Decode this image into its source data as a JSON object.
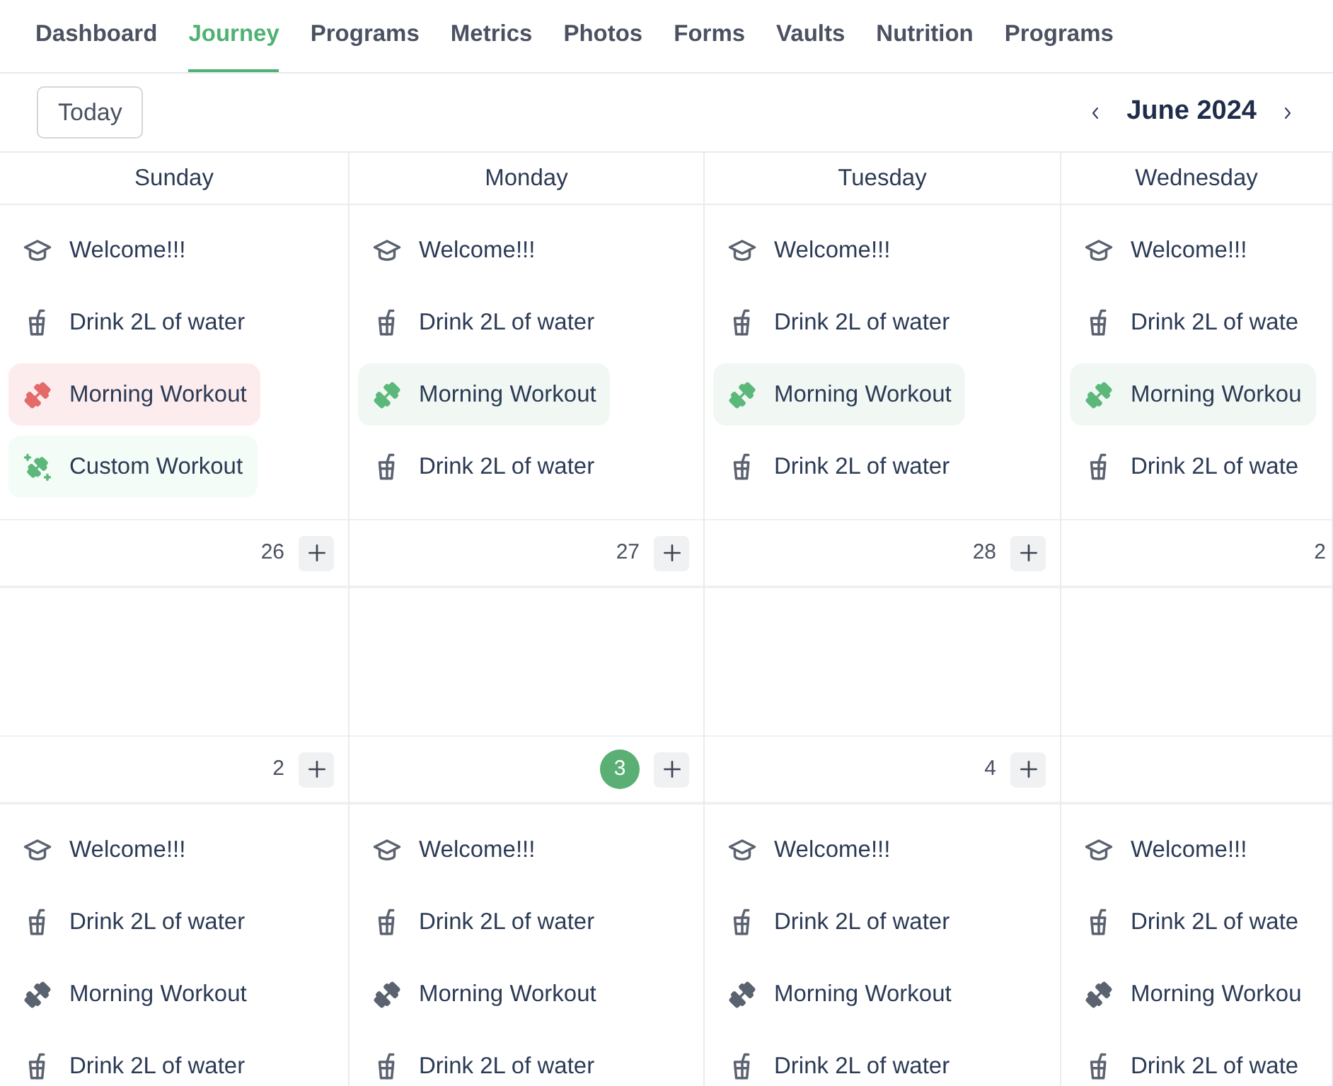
{
  "tabs": [
    {
      "label": "Dashboard",
      "selected": false
    },
    {
      "label": "Journey",
      "selected": true
    },
    {
      "label": "Programs",
      "selected": false
    },
    {
      "label": "Metrics",
      "selected": false
    },
    {
      "label": "Photos",
      "selected": false
    },
    {
      "label": "Forms",
      "selected": false
    },
    {
      "label": "Vaults",
      "selected": false
    },
    {
      "label": "Nutrition",
      "selected": false
    },
    {
      "label": "Programs",
      "selected": false
    }
  ],
  "toolbar": {
    "today_button": "Today",
    "month": "June 2024"
  },
  "calendar": {
    "days": [
      "Sunday",
      "Monday",
      "Tuesday",
      "Wednesday"
    ],
    "weeks": [
      {
        "cells": [
          {
            "events": [
              {
                "kind": "class",
                "title": "Welcome!!!"
              },
              {
                "kind": "water",
                "title": "Drink 2L of water"
              },
              {
                "kind": "workout",
                "title": "Morning Workout",
                "missed": true
              },
              {
                "kind": "custom_workout",
                "title": "Custom Workout",
                "missed": false,
                "done": true
              }
            ],
            "date": "26",
            "today": false,
            "add_button": true
          },
          {
            "events": [
              {
                "kind": "class",
                "title": "Welcome!!!"
              },
              {
                "kind": "water",
                "title": "Drink 2L of water"
              },
              {
                "kind": "workout",
                "title": "Morning Workout",
                "missed": false,
                "done": true
              },
              {
                "kind": "water",
                "title": "Drink 2L of water"
              }
            ],
            "date": "27",
            "today": false,
            "add_button": true
          },
          {
            "events": [
              {
                "kind": "class",
                "title": "Welcome!!!"
              },
              {
                "kind": "water",
                "title": "Drink 2L of water"
              },
              {
                "kind": "workout",
                "title": "Morning Workout",
                "missed": false,
                "done": true
              },
              {
                "kind": "water",
                "title": "Drink 2L of water"
              }
            ],
            "date": "28",
            "today": false,
            "add_button": true
          },
          {
            "events": [
              {
                "kind": "class",
                "title": "Welcome!!!"
              },
              {
                "kind": "water",
                "title": "Drink 2L of wate"
              },
              {
                "kind": "workout",
                "title": "Morning Workou",
                "missed": false,
                "done": true
              },
              {
                "kind": "water",
                "title": "Drink 2L of wate"
              }
            ],
            "date": "2",
            "today": false,
            "add_button": false
          }
        ]
      },
      {
        "cells": [
          {
            "date": "2",
            "today": false,
            "add_button": true
          },
          {
            "date": "3",
            "today": true,
            "add_button": true
          },
          {
            "date": "4",
            "today": false,
            "add_button": true
          },
          {
            "add_button": false
          }
        ]
      },
      {
        "cells": [
          {
            "events": [
              {
                "kind": "class",
                "title": "Welcome!!!"
              },
              {
                "kind": "water",
                "title": "Drink 2L of water"
              },
              {
                "kind": "workout",
                "title": "Morning Workout",
                "missed": false,
                "done": false
              },
              {
                "kind": "water",
                "title": "Drink 2L of water"
              }
            ]
          },
          {
            "events": [
              {
                "kind": "class",
                "title": "Welcome!!!"
              },
              {
                "kind": "water",
                "title": "Drink 2L of water"
              },
              {
                "kind": "workout",
                "title": "Morning Workout",
                "missed": false,
                "done": false
              },
              {
                "kind": "water",
                "title": "Drink 2L of water"
              }
            ]
          },
          {
            "events": [
              {
                "kind": "class",
                "title": "Welcome!!!"
              },
              {
                "kind": "water",
                "title": "Drink 2L of water"
              },
              {
                "kind": "workout",
                "title": "Morning Workout",
                "missed": false,
                "done": false
              },
              {
                "kind": "water",
                "title": "Drink 2L of water"
              }
            ]
          },
          {
            "events": [
              {
                "kind": "class",
                "title": "Welcome!!!"
              },
              {
                "kind": "water",
                "title": "Drink 2L of wate"
              },
              {
                "kind": "workout",
                "title": "Morning Workou",
                "missed": false,
                "done": false
              },
              {
                "kind": "water",
                "title": "Drink 2L of wate"
              }
            ]
          }
        ]
      }
    ]
  }
}
